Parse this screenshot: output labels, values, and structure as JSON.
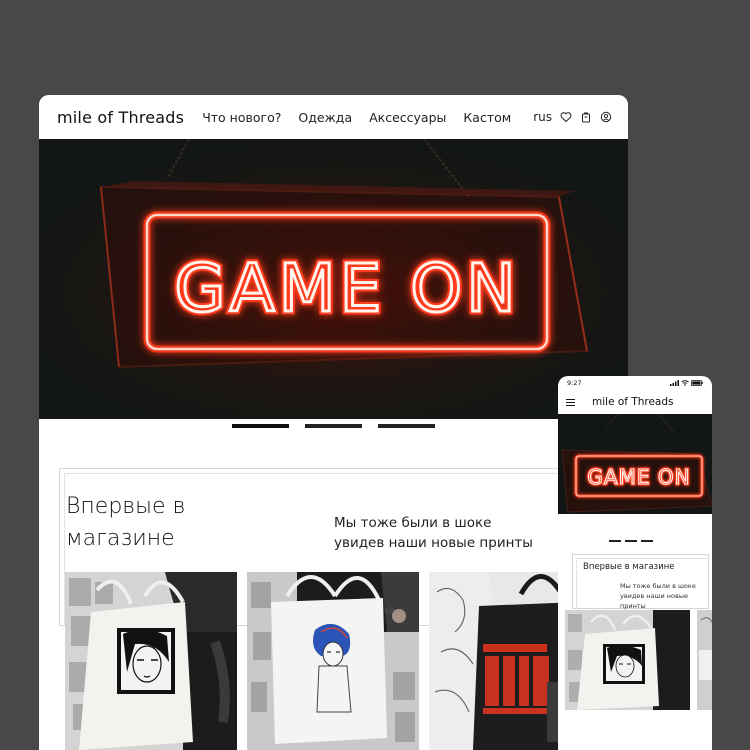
{
  "desktop": {
    "logo": "mile of Threads",
    "menu": [
      "Что нового?",
      "Одежда",
      "Аксессуары",
      "Кастом"
    ],
    "lang": "rus",
    "icons": [
      "heart-icon",
      "bag-icon",
      "user-icon"
    ],
    "hero": {
      "sign_text": "GAME ON"
    },
    "carousel": {
      "count": 3,
      "active": 1
    },
    "new_section": {
      "title_line1": "Впервые в",
      "title_line2": "магазине",
      "sub_line1": "Мы тоже были в шоке",
      "sub_line2": "увидев наши новые принты"
    }
  },
  "mobile": {
    "time": "9:27",
    "logo": "mile of Threads",
    "hero": {
      "sign_text": "GAME ON"
    },
    "new_section": {
      "title": "Впервые в магазине",
      "sub_line1": "Мы тоже были в шоке",
      "sub_line2": "увидев наши новые принты"
    }
  },
  "colors": {
    "background": "#484848",
    "neon": "#ff4a2a",
    "neon_core": "#fff1ea"
  }
}
